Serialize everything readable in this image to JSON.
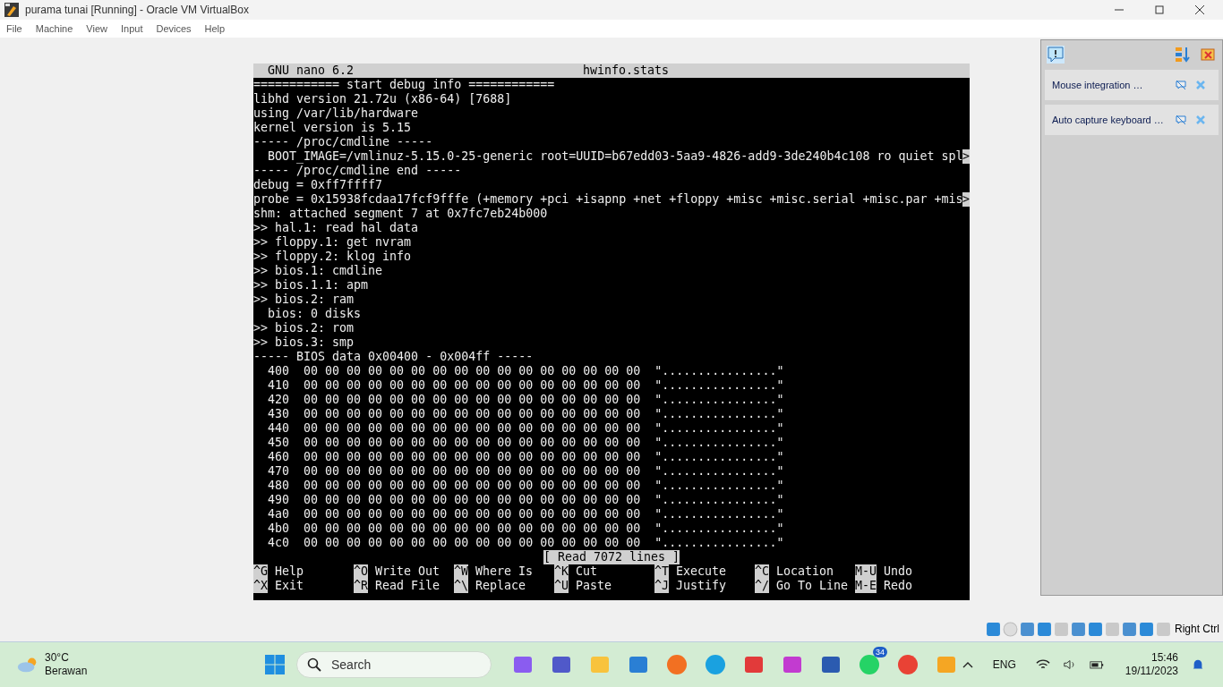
{
  "window": {
    "title": "purama tunai [Running] - Oracle VM VirtualBox"
  },
  "menu": [
    "File",
    "Machine",
    "View",
    "Input",
    "Devices",
    "Help"
  ],
  "nano": {
    "app": "GNU nano 6.2",
    "filename": "hwinfo.stats",
    "lines": [
      {
        "text": "============ start debug info ============"
      },
      {
        "text": "libhd version 21.72u (x86-64) [7688]"
      },
      {
        "text": "using /var/lib/hardware"
      },
      {
        "text": "kernel version is 5.15"
      },
      {
        "text": "----- /proc/cmdline -----"
      },
      {
        "text": "  BOOT_IMAGE=/vmlinuz-5.15.0-25-generic root=UUID=b67edd03-5aa9-4826-add9-3de240b4c108 ro quiet spl",
        "more": ">"
      },
      {
        "text": "----- /proc/cmdline end -----"
      },
      {
        "text": "debug = 0xff7ffff7"
      },
      {
        "text": "probe = 0x15938fcdaa17fcf9fffe (+memory +pci +isapnp +net +floppy +misc +misc.serial +misc.par +mis",
        "more": ">"
      },
      {
        "text": "shm: attached segment 7 at 0x7fc7eb24b000"
      },
      {
        "text": ">> hal.1: read hal data"
      },
      {
        "text": ">> floppy.1: get nvram"
      },
      {
        "text": ">> floppy.2: klog info"
      },
      {
        "text": ">> bios.1: cmdline"
      },
      {
        "text": ">> bios.1.1: apm"
      },
      {
        "text": ">> bios.2: ram"
      },
      {
        "text": "  bios: 0 disks"
      },
      {
        "text": ">> bios.2: rom"
      },
      {
        "text": ">> bios.3: smp"
      },
      {
        "text": "----- BIOS data 0x00400 - 0x004ff -----"
      },
      {
        "text": "  400  00 00 00 00 00 00 00 00 00 00 00 00 00 00 00 00  \"................\""
      },
      {
        "text": "  410  00 00 00 00 00 00 00 00 00 00 00 00 00 00 00 00  \"................\""
      },
      {
        "text": "  420  00 00 00 00 00 00 00 00 00 00 00 00 00 00 00 00  \"................\""
      },
      {
        "text": "  430  00 00 00 00 00 00 00 00 00 00 00 00 00 00 00 00  \"................\""
      },
      {
        "text": "  440  00 00 00 00 00 00 00 00 00 00 00 00 00 00 00 00  \"................\""
      },
      {
        "text": "  450  00 00 00 00 00 00 00 00 00 00 00 00 00 00 00 00  \"................\""
      },
      {
        "text": "  460  00 00 00 00 00 00 00 00 00 00 00 00 00 00 00 00  \"................\""
      },
      {
        "text": "  470  00 00 00 00 00 00 00 00 00 00 00 00 00 00 00 00  \"................\""
      },
      {
        "text": "  480  00 00 00 00 00 00 00 00 00 00 00 00 00 00 00 00  \"................\""
      },
      {
        "text": "  490  00 00 00 00 00 00 00 00 00 00 00 00 00 00 00 00  \"................\""
      },
      {
        "text": "  4a0  00 00 00 00 00 00 00 00 00 00 00 00 00 00 00 00  \"................\""
      },
      {
        "text": "  4b0  00 00 00 00 00 00 00 00 00 00 00 00 00 00 00 00  \"................\""
      },
      {
        "text": "  4c0  00 00 00 00 00 00 00 00 00 00 00 00 00 00 00 00  \"................\""
      }
    ],
    "status": "[ Read 7072 lines ]",
    "shortcuts": [
      [
        {
          "key": "^G",
          "label": "Help"
        },
        {
          "key": "^O",
          "label": "Write Out"
        },
        {
          "key": "^W",
          "label": "Where Is"
        },
        {
          "key": "^K",
          "label": "Cut"
        },
        {
          "key": "^T",
          "label": "Execute"
        },
        {
          "key": "^C",
          "label": "Location"
        },
        {
          "key": "M-U",
          "label": "Undo"
        }
      ],
      [
        {
          "key": "^X",
          "label": "Exit"
        },
        {
          "key": "^R",
          "label": "Read File"
        },
        {
          "key": "^\\",
          "label": "Replace"
        },
        {
          "key": "^U",
          "label": "Paste"
        },
        {
          "key": "^J",
          "label": "Justify"
        },
        {
          "key": "^/",
          "label": "Go To Line"
        },
        {
          "key": "M-E",
          "label": "Redo"
        }
      ]
    ]
  },
  "notifications": [
    {
      "text": "Mouse integration …"
    },
    {
      "text": "Auto capture keyboard …"
    }
  ],
  "status_bar": {
    "host_key": "Right Ctrl"
  },
  "taskbar": {
    "weather": {
      "temp": "30°C",
      "desc": "Berawan"
    },
    "search": {
      "placeholder": "Search"
    },
    "badge": "34",
    "lang": "ENG",
    "time": "15:46",
    "date": "19/11/2023"
  }
}
